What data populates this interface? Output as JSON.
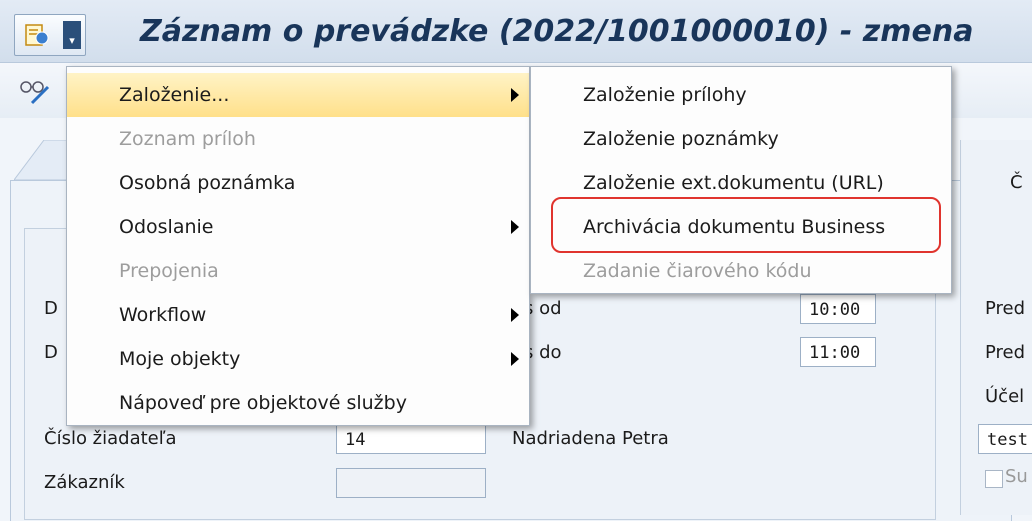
{
  "window": {
    "title": "Záznam o prevádzke (2022/1001000010) - zmena"
  },
  "toolbar": {
    "icon_text": "6ô"
  },
  "form": {
    "right_partial_top": "Č",
    "left_partial_1": "D",
    "left_partial_2": "D",
    "cas_od_label": "s od",
    "cas_od_value": "10:00",
    "cas_do_label": "s do",
    "cas_do_value": "11:00",
    "right_label_1": "Pred",
    "right_label_2": "Pred",
    "right_label_3": "Účel",
    "right_value_3": "test",
    "right_label_4": "Su",
    "ziadatel_label": "Číslo žiadateľa",
    "ziadatel_value": "14",
    "ziadatel_name": "Nadriadena Petra",
    "zakaznik_label": "Zákazník",
    "zakaznik_value": ""
  },
  "menu_main": {
    "items": [
      {
        "label": "Založenie...",
        "submenu": true,
        "disabled": false,
        "highlighted": true
      },
      {
        "label": "Zoznam príloh",
        "submenu": false,
        "disabled": true
      },
      {
        "label": "Osobná poznámka",
        "submenu": false,
        "disabled": false
      },
      {
        "label": "Odoslanie",
        "submenu": true,
        "disabled": false
      },
      {
        "label": "Prepojenia",
        "submenu": false,
        "disabled": true
      },
      {
        "label": "Workflow",
        "submenu": true,
        "disabled": false
      },
      {
        "label": "Moje objekty",
        "submenu": true,
        "disabled": false
      },
      {
        "label": "Nápoveď pre objektové služby",
        "submenu": false,
        "disabled": false
      }
    ]
  },
  "menu_sub": {
    "items": [
      {
        "label": "Založenie prílohy",
        "disabled": false
      },
      {
        "label": "Založenie poznámky",
        "disabled": false
      },
      {
        "label": "Založenie ext.dokumentu (URL)",
        "disabled": false
      },
      {
        "label": "Archivácia dokumentu Business",
        "disabled": false,
        "annotated": true
      },
      {
        "label": "Zadanie čiarového kódu",
        "disabled": true
      }
    ]
  },
  "colors": {
    "highlight": "#ffe08a",
    "annotation": "#e0342e",
    "title": "#19355a"
  }
}
